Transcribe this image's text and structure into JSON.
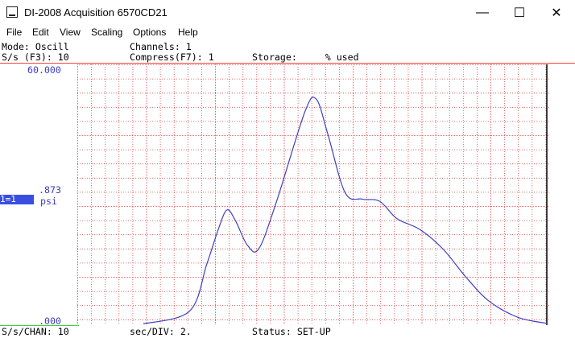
{
  "window": {
    "title": "DI-2008 Acquisition 6570CD21",
    "minimize": "—",
    "maximize": "☐",
    "close": "✕"
  },
  "menu": [
    "File",
    "Edit",
    "View",
    "Scaling",
    "Options",
    "Help"
  ],
  "info": {
    "mode": "Mode: Oscill",
    "channels": "Channels: 1",
    "sps": "S/s (F3): 10",
    "compress": "Compress(F7): 1",
    "storage": "Storage:     % used"
  },
  "axis": {
    "top": "60.000",
    "mid": ".873",
    "bottom": ".000",
    "unit": "psi",
    "channel": "1=1"
  },
  "status": {
    "sps_chan": "S/s/CHAN: 10",
    "sec_div": "sec/DIV: 2.",
    "status": "Status: SET-UP"
  },
  "colors": {
    "grid": "#e04040",
    "trace": "#4040c0",
    "channel_bg": "#3a4fe0"
  },
  "chart_data": {
    "type": "line",
    "ylim": [
      0,
      60
    ],
    "x_divisions": 34,
    "trace": [
      [
        0,
        0.3
      ],
      [
        0.08,
        3.2
      ],
      [
        0.11,
        14
      ],
      [
        0.13,
        22
      ],
      [
        0.145,
        26.5
      ],
      [
        0.16,
        24
      ],
      [
        0.18,
        18.5
      ],
      [
        0.2,
        17.5
      ],
      [
        0.23,
        28
      ],
      [
        0.28,
        49
      ],
      [
        0.3,
        52
      ],
      [
        0.32,
        44
      ],
      [
        0.35,
        30.5
      ],
      [
        0.38,
        29
      ],
      [
        0.41,
        28.5
      ],
      [
        0.44,
        24.5
      ],
      [
        0.48,
        22
      ],
      [
        0.52,
        17.5
      ],
      [
        0.56,
        11
      ],
      [
        0.6,
        5.5
      ],
      [
        0.65,
        1.8
      ],
      [
        0.7,
        0.4
      ]
    ]
  }
}
